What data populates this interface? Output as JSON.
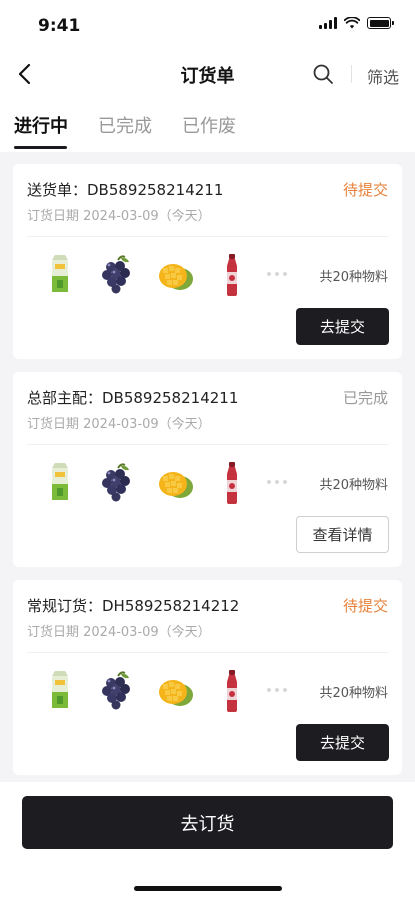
{
  "status_bar": {
    "time": "9:41"
  },
  "nav": {
    "title": "订货单",
    "filter_label": "筛选"
  },
  "tabs": [
    {
      "label": "进行中",
      "active": true
    },
    {
      "label": "已完成",
      "active": false
    },
    {
      "label": "已作废",
      "active": false
    }
  ],
  "orders": [
    {
      "title": "送货单：DB589258214211",
      "status": "待提交",
      "status_color": "#e8823a",
      "date": "订货日期 2024-03-09（今天）",
      "products": [
        "juice-carton-icon",
        "grapes-icon",
        "mango-icon",
        "bottle-icon"
      ],
      "count": "共20种物料",
      "action": "去提交",
      "action_style": "dark"
    },
    {
      "title": "总部主配：DB589258214211",
      "status": "已完成",
      "status_color": "#999999",
      "date": "订货日期 2024-03-09（今天）",
      "products": [
        "juice-carton-icon",
        "grapes-icon",
        "mango-icon",
        "bottle-icon"
      ],
      "count": "共20种物料",
      "action": "查看详情",
      "action_style": "outline"
    },
    {
      "title": "常规订货：DH589258214212",
      "status": "待提交",
      "status_color": "#e8823a",
      "date": "订货日期 2024-03-09（今天）",
      "products": [
        "juice-carton-icon",
        "grapes-icon",
        "mango-icon",
        "bottle-icon"
      ],
      "count": "共20种物料",
      "action": "去提交",
      "action_style": "dark"
    }
  ],
  "bottom": {
    "order_button": "去订货"
  }
}
